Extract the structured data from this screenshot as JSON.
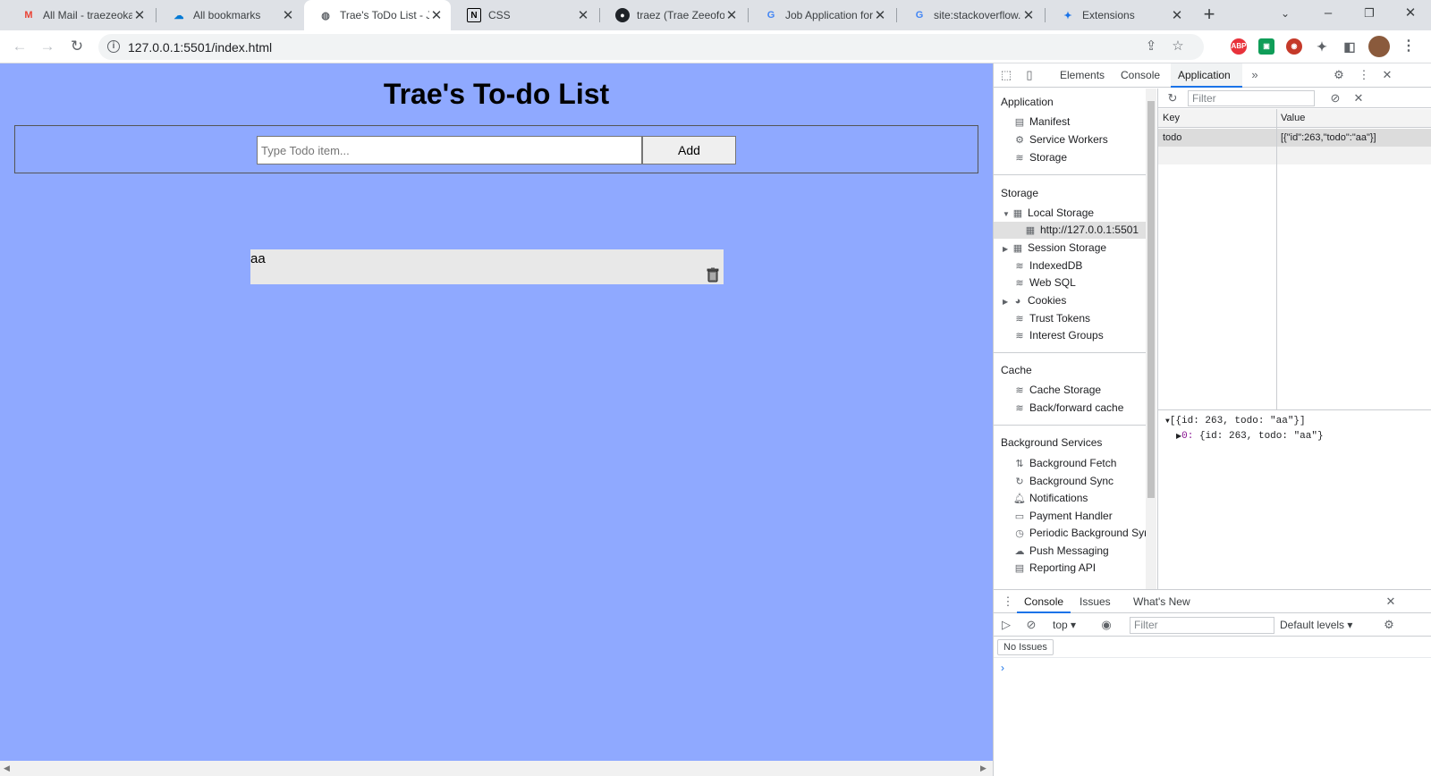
{
  "browser": {
    "tabs": [
      {
        "title": "All Mail - traezeoka",
        "icon": "gmail-icon",
        "active": false
      },
      {
        "title": "All bookmarks",
        "icon": "onedrive-icon",
        "active": false
      },
      {
        "title": "Trae's ToDo List - Ja",
        "icon": "globe-icon",
        "active": true
      },
      {
        "title": "CSS",
        "icon": "notion-icon",
        "active": false
      },
      {
        "title": "traez (Trae Zeeofor",
        "icon": "github-icon",
        "active": false
      },
      {
        "title": "Job Application for",
        "icon": "google-icon",
        "active": false
      },
      {
        "title": "site:stackoverflow.c",
        "icon": "google-icon",
        "active": false
      },
      {
        "title": "Extensions",
        "icon": "puzzle-icon",
        "active": false
      }
    ],
    "url": "127.0.0.1:5501/index.html",
    "extensions": [
      {
        "label": "ABP",
        "color": "#e8323b"
      }
    ]
  },
  "page": {
    "title": "Trae's To-do List",
    "input_placeholder": "Type Todo item...",
    "add_label": "Add",
    "todos": [
      {
        "text": "aa"
      }
    ],
    "background": "#8fa9ff"
  },
  "devtools": {
    "tabs": [
      "Elements",
      "Console",
      "Application"
    ],
    "active_tab": "Application",
    "sidebar": {
      "application_header": "Application",
      "application_items": [
        "Manifest",
        "Service Workers",
        "Storage"
      ],
      "storage_header": "Storage",
      "local_storage": "Local Storage",
      "local_storage_origin": "http://127.0.0.1:5501",
      "storage_items": [
        "Session Storage",
        "IndexedDB",
        "Web SQL",
        "Cookies",
        "Trust Tokens",
        "Interest Groups"
      ],
      "cache_header": "Cache",
      "cache_items": [
        "Cache Storage",
        "Back/forward cache"
      ],
      "bg_header": "Background Services",
      "bg_items": [
        "Background Fetch",
        "Background Sync",
        "Notifications",
        "Payment Handler",
        "Periodic Background Syr",
        "Push Messaging",
        "Reporting API"
      ]
    },
    "storage_table": {
      "filter_placeholder": "Filter",
      "key_header": "Key",
      "value_header": "Value",
      "rows": [
        {
          "key": "todo",
          "value": "[{\"id\":263,\"todo\":\"aa\"}]"
        }
      ]
    },
    "preview": {
      "line1": "[{id: 263, todo: \"aa\"}]",
      "line2_key": "0:",
      "line2_val": "{id: 263, todo: \"aa\"}"
    },
    "drawer": {
      "tabs": [
        "Console",
        "Issues",
        "What's New"
      ],
      "active_tab": "Console",
      "context": "top",
      "filter_placeholder": "Filter",
      "levels": "Default levels",
      "issues": "No Issues"
    }
  }
}
